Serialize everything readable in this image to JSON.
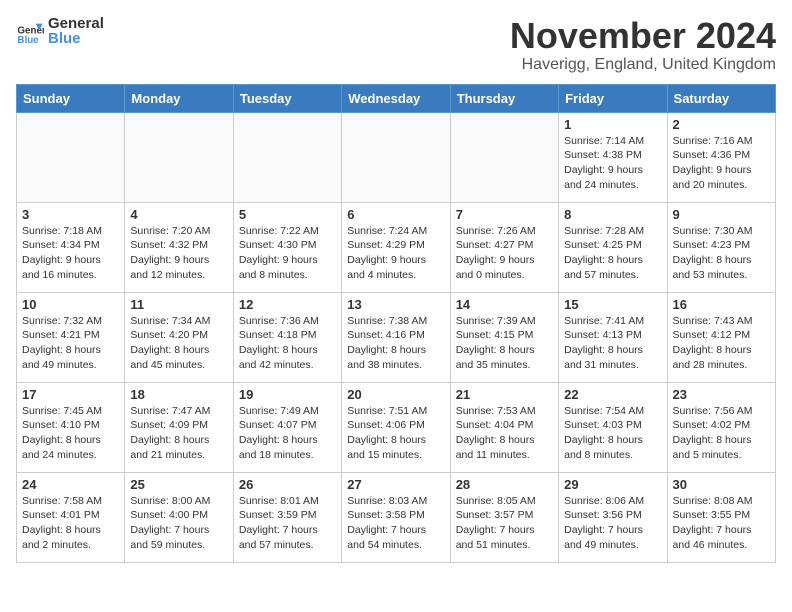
{
  "logo": {
    "general": "General",
    "blue": "Blue"
  },
  "header": {
    "month": "November 2024",
    "location": "Haverigg, England, United Kingdom"
  },
  "weekdays": [
    "Sunday",
    "Monday",
    "Tuesday",
    "Wednesday",
    "Thursday",
    "Friday",
    "Saturday"
  ],
  "weeks": [
    [
      {
        "day": "",
        "info": ""
      },
      {
        "day": "",
        "info": ""
      },
      {
        "day": "",
        "info": ""
      },
      {
        "day": "",
        "info": ""
      },
      {
        "day": "",
        "info": ""
      },
      {
        "day": "1",
        "info": "Sunrise: 7:14 AM\nSunset: 4:38 PM\nDaylight: 9 hours\nand 24 minutes."
      },
      {
        "day": "2",
        "info": "Sunrise: 7:16 AM\nSunset: 4:36 PM\nDaylight: 9 hours\nand 20 minutes."
      }
    ],
    [
      {
        "day": "3",
        "info": "Sunrise: 7:18 AM\nSunset: 4:34 PM\nDaylight: 9 hours\nand 16 minutes."
      },
      {
        "day": "4",
        "info": "Sunrise: 7:20 AM\nSunset: 4:32 PM\nDaylight: 9 hours\nand 12 minutes."
      },
      {
        "day": "5",
        "info": "Sunrise: 7:22 AM\nSunset: 4:30 PM\nDaylight: 9 hours\nand 8 minutes."
      },
      {
        "day": "6",
        "info": "Sunrise: 7:24 AM\nSunset: 4:29 PM\nDaylight: 9 hours\nand 4 minutes."
      },
      {
        "day": "7",
        "info": "Sunrise: 7:26 AM\nSunset: 4:27 PM\nDaylight: 9 hours\nand 0 minutes."
      },
      {
        "day": "8",
        "info": "Sunrise: 7:28 AM\nSunset: 4:25 PM\nDaylight: 8 hours\nand 57 minutes."
      },
      {
        "day": "9",
        "info": "Sunrise: 7:30 AM\nSunset: 4:23 PM\nDaylight: 8 hours\nand 53 minutes."
      }
    ],
    [
      {
        "day": "10",
        "info": "Sunrise: 7:32 AM\nSunset: 4:21 PM\nDaylight: 8 hours\nand 49 minutes."
      },
      {
        "day": "11",
        "info": "Sunrise: 7:34 AM\nSunset: 4:20 PM\nDaylight: 8 hours\nand 45 minutes."
      },
      {
        "day": "12",
        "info": "Sunrise: 7:36 AM\nSunset: 4:18 PM\nDaylight: 8 hours\nand 42 minutes."
      },
      {
        "day": "13",
        "info": "Sunrise: 7:38 AM\nSunset: 4:16 PM\nDaylight: 8 hours\nand 38 minutes."
      },
      {
        "day": "14",
        "info": "Sunrise: 7:39 AM\nSunset: 4:15 PM\nDaylight: 8 hours\nand 35 minutes."
      },
      {
        "day": "15",
        "info": "Sunrise: 7:41 AM\nSunset: 4:13 PM\nDaylight: 8 hours\nand 31 minutes."
      },
      {
        "day": "16",
        "info": "Sunrise: 7:43 AM\nSunset: 4:12 PM\nDaylight: 8 hours\nand 28 minutes."
      }
    ],
    [
      {
        "day": "17",
        "info": "Sunrise: 7:45 AM\nSunset: 4:10 PM\nDaylight: 8 hours\nand 24 minutes."
      },
      {
        "day": "18",
        "info": "Sunrise: 7:47 AM\nSunset: 4:09 PM\nDaylight: 8 hours\nand 21 minutes."
      },
      {
        "day": "19",
        "info": "Sunrise: 7:49 AM\nSunset: 4:07 PM\nDaylight: 8 hours\nand 18 minutes."
      },
      {
        "day": "20",
        "info": "Sunrise: 7:51 AM\nSunset: 4:06 PM\nDaylight: 8 hours\nand 15 minutes."
      },
      {
        "day": "21",
        "info": "Sunrise: 7:53 AM\nSunset: 4:04 PM\nDaylight: 8 hours\nand 11 minutes."
      },
      {
        "day": "22",
        "info": "Sunrise: 7:54 AM\nSunset: 4:03 PM\nDaylight: 8 hours\nand 8 minutes."
      },
      {
        "day": "23",
        "info": "Sunrise: 7:56 AM\nSunset: 4:02 PM\nDaylight: 8 hours\nand 5 minutes."
      }
    ],
    [
      {
        "day": "24",
        "info": "Sunrise: 7:58 AM\nSunset: 4:01 PM\nDaylight: 8 hours\nand 2 minutes."
      },
      {
        "day": "25",
        "info": "Sunrise: 8:00 AM\nSunset: 4:00 PM\nDaylight: 7 hours\nand 59 minutes."
      },
      {
        "day": "26",
        "info": "Sunrise: 8:01 AM\nSunset: 3:59 PM\nDaylight: 7 hours\nand 57 minutes."
      },
      {
        "day": "27",
        "info": "Sunrise: 8:03 AM\nSunset: 3:58 PM\nDaylight: 7 hours\nand 54 minutes."
      },
      {
        "day": "28",
        "info": "Sunrise: 8:05 AM\nSunset: 3:57 PM\nDaylight: 7 hours\nand 51 minutes."
      },
      {
        "day": "29",
        "info": "Sunrise: 8:06 AM\nSunset: 3:56 PM\nDaylight: 7 hours\nand 49 minutes."
      },
      {
        "day": "30",
        "info": "Sunrise: 8:08 AM\nSunset: 3:55 PM\nDaylight: 7 hours\nand 46 minutes."
      }
    ]
  ]
}
